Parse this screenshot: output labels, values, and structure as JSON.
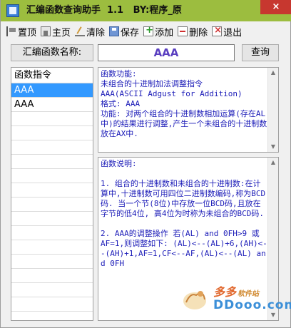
{
  "window": {
    "title": "汇编函数查询助手  1.1   BY:程序_原",
    "close_glyph": "×"
  },
  "toolbar": {
    "items": [
      {
        "label": "置顶",
        "icon": "pin-icon"
      },
      {
        "label": "主页",
        "icon": "home-icon"
      },
      {
        "label": "清除",
        "icon": "clear-icon"
      },
      {
        "label": "保存",
        "icon": "save-icon"
      },
      {
        "label": "添加",
        "icon": "add-icon"
      },
      {
        "label": "删除",
        "icon": "delete-icon"
      },
      {
        "label": "退出",
        "icon": "exit-icon"
      }
    ]
  },
  "search": {
    "label": "汇编函数名称:",
    "value": "AAA",
    "button": "查询"
  },
  "list": {
    "header": "函数指令",
    "items": [
      "AAA",
      "AAA"
    ],
    "selected_index": 0
  },
  "function_info": {
    "text": "函数功能:\n未组合的十进制加法调整指令\nAAA(ASCII Adgust for Addition)\n格式: AAA\n功能: 对两个组合的十进制数相加运算(存在AL中)的结果进行调整,产生一个未组合的十进制数放在AX中."
  },
  "function_desc": {
    "text": "函数说明:\n\n1. 组合的十进制数和未组合的十进制数:在计算中,十进制数可用四位二进制数编码,称为BCD码. 当一个节(8位)中存放一位BCD码,且放在字节的低4位, 高4位为时称为未组合的BCD码.\n\n2. AAA的调整操作 若(AL) and 0FH>9 或 AF=1,则调整如下: (AL)<--(AL)+6,(AH)<--(AH)+1,AF=1,CF<--AF,(AL)<--(AL) and 0FH"
  },
  "watermark": {
    "top": "多多",
    "top_small": "软件站",
    "bottom": "DDooo.com"
  },
  "colors": {
    "titlebar": "#9cbd3f",
    "close": "#c7372f",
    "selected": "#3399ff",
    "body_text": "#1c1cb8",
    "search_value": "#5a3fc0"
  }
}
